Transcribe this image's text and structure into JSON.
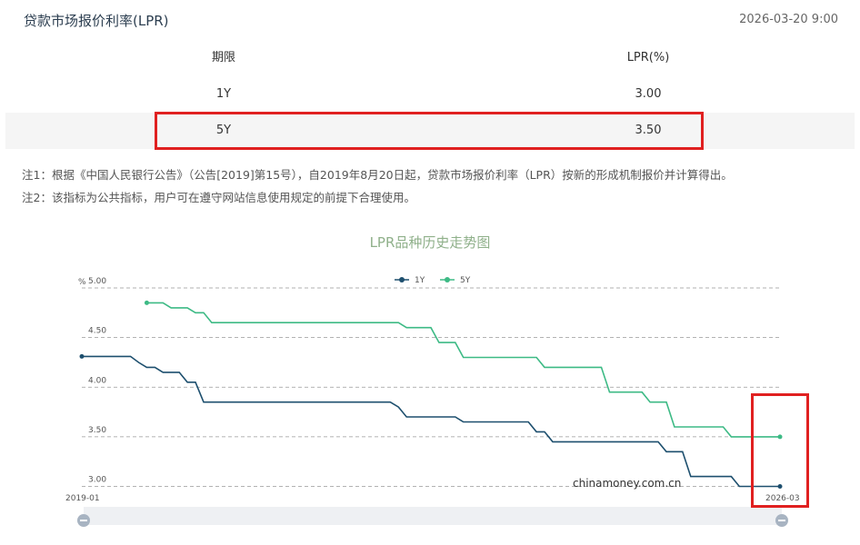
{
  "header": {
    "title": "贷款市场报价利率(LPR)",
    "timestamp": "2026-03-20 9:00"
  },
  "table": {
    "headers": [
      "期限",
      "LPR(%)"
    ],
    "rows": [
      {
        "term": "1Y",
        "rate": "3.00"
      },
      {
        "term": "5Y",
        "rate": "3.50"
      }
    ]
  },
  "notes": [
    "注1：根据《中国人民银行公告》（公告[2019]第15号），自2019年8月20日起，贷款市场报价利率（LPR）按新的形成机制报价并计算得出。",
    "注2：该指标为公共指标，用户可在遵守网站信息使用规定的前提下合理使用。"
  ],
  "chart_data": {
    "type": "line",
    "title": "LPR品种历史走势图",
    "ylabel": "%",
    "x_start_label": "2019-01",
    "x_end_label": "2026-03",
    "x_range": [
      0,
      86
    ],
    "ylim": [
      2.95,
      5.0
    ],
    "yticks": [
      "3.00",
      "3.50",
      "4.00",
      "4.50",
      "5.00"
    ],
    "legend_position": "top-center",
    "watermark": "chinamoney.com.cn",
    "series": [
      {
        "name": "1Y",
        "color": "#1d4f6e",
        "points": [
          [
            0,
            4.31
          ],
          [
            6,
            4.31
          ],
          [
            7,
            4.25
          ],
          [
            8,
            4.2
          ],
          [
            9,
            4.2
          ],
          [
            10,
            4.15
          ],
          [
            12,
            4.15
          ],
          [
            13,
            4.05
          ],
          [
            14,
            4.05
          ],
          [
            15,
            3.85
          ],
          [
            38,
            3.85
          ],
          [
            39,
            3.8
          ],
          [
            40,
            3.7
          ],
          [
            46,
            3.7
          ],
          [
            47,
            3.65
          ],
          [
            55,
            3.65
          ],
          [
            56,
            3.55
          ],
          [
            57,
            3.55
          ],
          [
            58,
            3.45
          ],
          [
            71,
            3.45
          ],
          [
            72,
            3.35
          ],
          [
            74,
            3.35
          ],
          [
            75,
            3.1
          ],
          [
            80,
            3.1
          ],
          [
            81,
            3.0
          ],
          [
            86,
            3.0
          ]
        ]
      },
      {
        "name": "5Y",
        "color": "#3dba85",
        "points": [
          [
            8,
            4.85
          ],
          [
            10,
            4.85
          ],
          [
            11,
            4.8
          ],
          [
            13,
            4.8
          ],
          [
            14,
            4.75
          ],
          [
            15,
            4.75
          ],
          [
            16,
            4.65
          ],
          [
            39,
            4.65
          ],
          [
            40,
            4.6
          ],
          [
            43,
            4.6
          ],
          [
            44,
            4.45
          ],
          [
            46,
            4.45
          ],
          [
            47,
            4.3
          ],
          [
            56,
            4.3
          ],
          [
            57,
            4.2
          ],
          [
            64,
            4.2
          ],
          [
            65,
            3.95
          ],
          [
            69,
            3.95
          ],
          [
            70,
            3.85
          ],
          [
            72,
            3.85
          ],
          [
            73,
            3.6
          ],
          [
            79,
            3.6
          ],
          [
            80,
            3.5
          ],
          [
            86,
            3.5
          ]
        ]
      }
    ]
  }
}
